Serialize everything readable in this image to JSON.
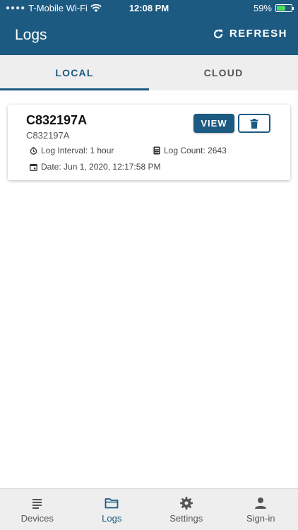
{
  "status_bar": {
    "carrier": "T-Mobile Wi-Fi",
    "time": "12:08 PM",
    "battery": "59%",
    "battery_level": 0.59
  },
  "header": {
    "title": "Logs",
    "refresh_label": "REFRESH"
  },
  "tabs": [
    {
      "label": "LOCAL",
      "active": true
    },
    {
      "label": "CLOUD",
      "active": false
    }
  ],
  "log_card": {
    "title": "C832197A",
    "subtitle": "C832197A",
    "log_interval": "Log Interval: 1 hour",
    "log_count": "Log Count: 2643",
    "date": "Date: Jun 1, 2020, 12:17:58 PM",
    "view_label": "VIEW"
  },
  "bottom_nav": [
    {
      "label": "Devices",
      "icon": "devices-icon",
      "active": false
    },
    {
      "label": "Logs",
      "icon": "folder-icon",
      "active": true
    },
    {
      "label": "Settings",
      "icon": "gear-icon",
      "active": false
    },
    {
      "label": "Sign-in",
      "icon": "person-icon",
      "active": false
    }
  ],
  "colors": {
    "primary": "#1d5a82",
    "tab_bar_bg": "#eeeeee",
    "battery_fill": "#4cd964"
  }
}
